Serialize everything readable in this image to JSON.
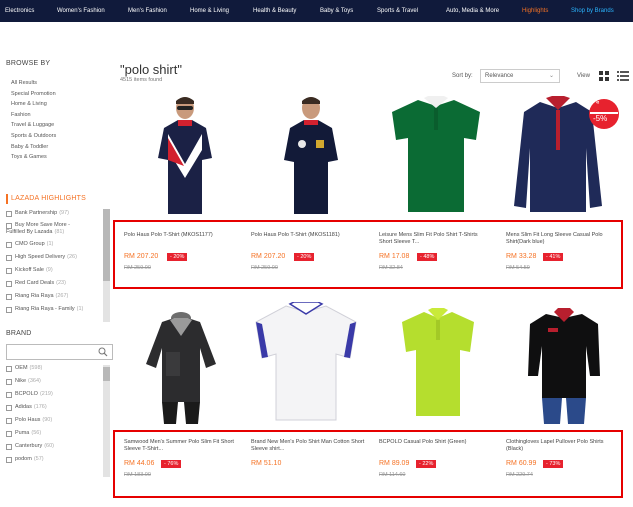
{
  "nav": {
    "items": [
      "Electronics",
      "Women's Fashion",
      "Men's Fashion",
      "Home & Living",
      "Health & Beauty",
      "Baby & Toys",
      "Sports & Travel",
      "Auto, Media & More",
      "Highlights",
      "Shop by Brands"
    ]
  },
  "sidebar": {
    "browse_title": "BROWSE BY",
    "browse_items": [
      "All Results",
      "Special Promotion",
      "Home & Living",
      "Fashion",
      "Travel & Luggage",
      "Sports & Outdoors",
      "Baby & Toddler",
      "Toys & Games"
    ],
    "highlights_title": "LAZADA HIGHLIGHTS",
    "highlights": [
      {
        "label": "Bank Partnership",
        "count": "(97)"
      },
      {
        "label": "Buy More Save More -",
        "count": ""
      },
      {
        "label": "Fulfilled By Lazada",
        "count": "(81)"
      },
      {
        "label": "CMO Group",
        "count": "(1)"
      },
      {
        "label": "High Speed Delivery",
        "count": "(26)"
      },
      {
        "label": "Kickoff Sale",
        "count": "(9)"
      },
      {
        "label": "Red Card Deals",
        "count": "(23)"
      },
      {
        "label": "Riang Ria Raya",
        "count": "(267)"
      },
      {
        "label": "Riang Ria Raya - Family",
        "count": "(1)"
      }
    ],
    "brand_title": "BRAND",
    "brands": [
      {
        "label": "OEM",
        "count": "(598)"
      },
      {
        "label": "Nike",
        "count": "(364)"
      },
      {
        "label": "BCPOLO",
        "count": "(219)"
      },
      {
        "label": "Adidas",
        "count": "(176)"
      },
      {
        "label": "Polo Haus",
        "count": "(90)"
      },
      {
        "label": "Puma",
        "count": "(56)"
      },
      {
        "label": "Canterbury",
        "count": "(60)"
      },
      {
        "label": "podom",
        "count": "(57)"
      }
    ]
  },
  "search": {
    "query": "\"polo shirt\"",
    "count": "4515 items found",
    "sort_label": "Sort by:",
    "sort_value": "Relevance",
    "view_label": "View"
  },
  "products": [
    {
      "name": "Polo Haus Polo T-Shirt (MKOS1177)",
      "price": "RM 207.20",
      "discount": "- 20%",
      "original": "RM 259.00"
    },
    {
      "name": "Polo Haus Polo T-Shirt (MKOS1181)",
      "price": "RM 207.20",
      "discount": "- 20%",
      "original": "RM 259.00"
    },
    {
      "name": "Leisure Mens Slim Fit Polo Shirt T-Shirts Short Sleeve T...",
      "price": "RM 17.08",
      "discount": "- 48%",
      "original": "RM 32.84"
    },
    {
      "name": "Mens Slim Fit Long Sleeve Casual Polo Shirt(Dark blue)",
      "price": "RM 33.28",
      "discount": "- 41%",
      "original": "RM 54.59"
    },
    {
      "name": "Samwood Men's Summer Polo Slim Fit Short Sleeve T-Shirt...",
      "price": "RM 44.06",
      "discount": "- 76%",
      "original": "RM 183.00"
    },
    {
      "name": "Brand New Men's Polo Shirt Man Cotton Short Sleeve shirt...",
      "price": "RM 51.10",
      "discount": "",
      "original": ""
    },
    {
      "name": "BCPOLO Casual Polo Shirt (Green)",
      "price": "RM 89.09",
      "discount": "- 22%",
      "original": "RM 114.60"
    },
    {
      "name": "Clothingloves Lapel Pullover Polo Shirts (Black)",
      "price": "RM 60.99",
      "discount": "- 73%",
      "original": "RM 229.74"
    }
  ],
  "badge": {
    "top": "«",
    "value": "-5%"
  }
}
